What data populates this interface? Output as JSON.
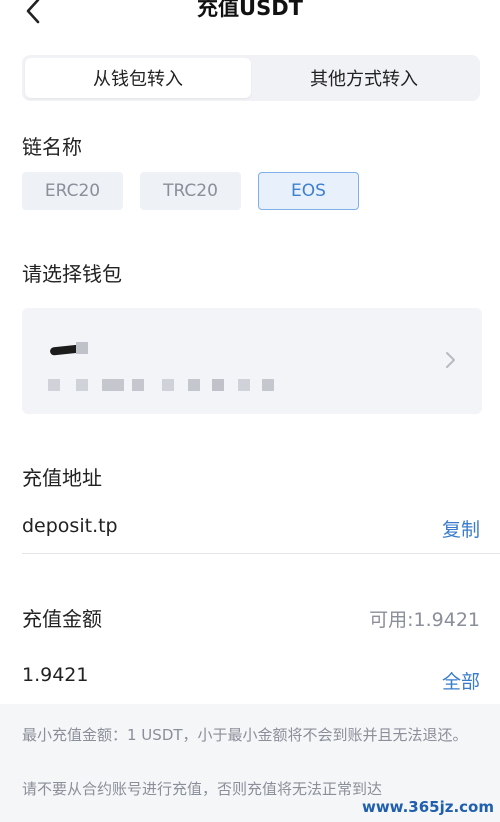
{
  "header": {
    "title": "充值USDT"
  },
  "tabs": [
    {
      "label": "从钱包转入",
      "active": true
    },
    {
      "label": "其他方式转入",
      "active": false
    }
  ],
  "chain": {
    "label": "链名称",
    "options": [
      {
        "label": "ERC20",
        "selected": false
      },
      {
        "label": "TRC20",
        "selected": false
      },
      {
        "label": "EOS",
        "selected": true
      }
    ]
  },
  "wallet": {
    "label": "请选择钱包",
    "blurred": true
  },
  "deposit_address": {
    "label": "充值地址",
    "value": "deposit.tp",
    "copy_label": "复制"
  },
  "amount": {
    "label": "充值金额",
    "available": "可用:1.9421",
    "value": "1.9421",
    "all_label": "全部"
  },
  "notes": [
    "最小充值金额：1 USDT，小于最小金额将不会到账并且无法退还。",
    "请不要从合约账号进行充值，否则充值将无法正常到达"
  ],
  "watermark": "www.365jz.com",
  "colors": {
    "accent": "#3a7ccc",
    "chip_selected_bg": "#e8f1fb",
    "muted_text": "#8a8f99"
  }
}
